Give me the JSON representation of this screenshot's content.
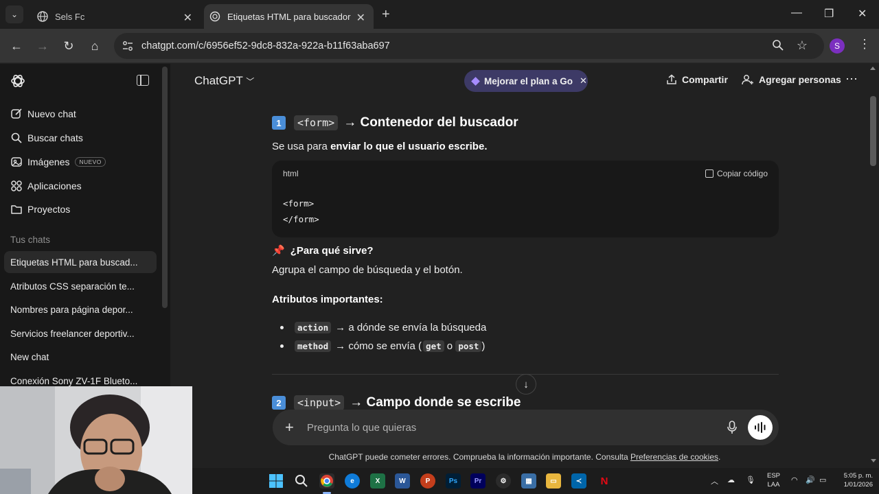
{
  "browser": {
    "tabs": [
      {
        "title": "Sels Fc",
        "active": false
      },
      {
        "title": "Etiquetas HTML para buscador",
        "active": true
      }
    ],
    "url": "chatgpt.com/c/6956ef52-9dc8-832a-922a-b11f63aba697",
    "profile_initial": "S"
  },
  "sidebar": {
    "actions": [
      {
        "label": "Nuevo chat",
        "icon": "edit-icon"
      },
      {
        "label": "Buscar chats",
        "icon": "search-icon"
      },
      {
        "label": "Imágenes",
        "icon": "images-icon",
        "badge": "NUEVO"
      },
      {
        "label": "Aplicaciones",
        "icon": "apps-icon"
      },
      {
        "label": "Proyectos",
        "icon": "folder-icon"
      }
    ],
    "section_title": "Tus chats",
    "chats": [
      "Etiquetas HTML para buscad...",
      "Atributos CSS separación te...",
      "Nombres para página depor...",
      "Servicios freelancer deportiv...",
      "New chat",
      "Conexión Sony ZV-1F Blueto..."
    ]
  },
  "header": {
    "model": "ChatGPT",
    "upgrade_label": "Mejorar el plan a Go",
    "share_label": "Compartir",
    "add_people_label": "Agregar personas"
  },
  "content": {
    "section1": {
      "number": "1",
      "tag": "<form>",
      "title": "→ Contenedor del buscador",
      "intro_prefix": "Se usa para ",
      "intro_bold": "enviar lo que el usuario escribe."
    },
    "codeblock": {
      "lang": "html",
      "copy_label": "Copiar código",
      "lines": [
        "<form>",
        "</form>"
      ]
    },
    "purpose_title": "¿Para qué sirve?",
    "purpose_text": "Agrupa el campo de búsqueda y el botón.",
    "attrs_title": "Atributos importantes:",
    "attr1": {
      "code": "action",
      "text": "→ a dónde se envía la búsqueda"
    },
    "attr2": {
      "code": "method",
      "text_before": "→ cómo se envía (",
      "code_a": "get",
      "mid": " o ",
      "code_b": "post",
      "text_after": ")"
    },
    "section2": {
      "number": "2",
      "tag": "<input>",
      "title": "→ Campo donde se escribe"
    }
  },
  "composer": {
    "placeholder": "Pregunta lo que quieras"
  },
  "disclaimer": {
    "text": "ChatGPT puede cometer errores. Comprueba la información importante. Consulta ",
    "link": "Preferencias de cookies",
    "end": "."
  },
  "taskbar": {
    "lang_top": "ESP",
    "lang_bottom": "LAA",
    "time": "5:05 p. m.",
    "date": "1/01/2026"
  },
  "colors": {
    "accent_upgrade": "#3d3a66",
    "number_badge": "#4a8ed8",
    "pin": "#e0445c"
  }
}
